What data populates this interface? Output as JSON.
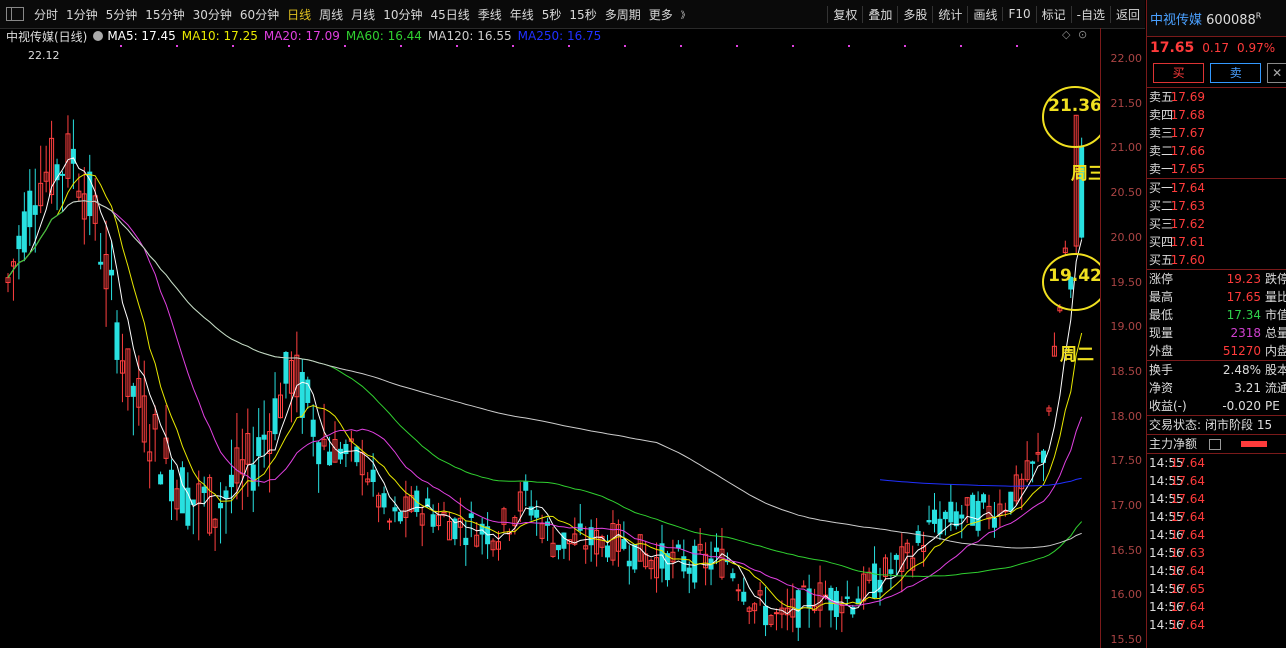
{
  "toolbar": {
    "periods": [
      "分时",
      "1分钟",
      "5分钟",
      "15分钟",
      "30分钟",
      "60分钟",
      "日线",
      "周线",
      "月线",
      "10分钟",
      "45日线",
      "季线",
      "年线",
      "5秒",
      "15秒",
      "多周期",
      "更多"
    ],
    "active_period": "日线",
    "more_arrow": "》",
    "tools": [
      "复权",
      "叠加",
      "多股",
      "统计",
      "画线",
      "F10",
      "标记",
      "-自选",
      "返回"
    ]
  },
  "legend": {
    "title": "中视传媒(日线)",
    "ma5": "MA5: 17.45",
    "ma10": "MA10: 17.25",
    "ma20": "MA20: 17.09",
    "ma60": "MA60: 16.44",
    "ma120": "MA120: 16.55",
    "ma250": "MA250: 16.75",
    "colors": {
      "ma5": "#ffffff",
      "ma10": "#e8e800",
      "ma20": "#e040e0",
      "ma60": "#30d030",
      "ma120": "#cccccc",
      "ma250": "#2030ff"
    }
  },
  "annotations": {
    "max_label": "22.12",
    "circle1": "21.36",
    "circle1_note": "周三",
    "circle2": "19.42",
    "circle2_note": "周二"
  },
  "price_axis": [
    "22.00",
    "21.50",
    "21.00",
    "20.50",
    "20.00",
    "19.50",
    "19.00",
    "18.50",
    "18.00",
    "17.50",
    "17.00",
    "16.50",
    "16.00",
    "15.50"
  ],
  "panel": {
    "name": "中视传媒",
    "code": "600088",
    "code_suffix": "R",
    "price": "17.65",
    "change": "0.17",
    "pct": "0.97%",
    "buy_label": "买",
    "sell_label": "卖",
    "asks": [
      {
        "label": "卖五",
        "price": "17.69"
      },
      {
        "label": "卖四",
        "price": "17.68"
      },
      {
        "label": "卖三",
        "price": "17.67"
      },
      {
        "label": "卖二",
        "price": "17.66"
      },
      {
        "label": "卖一",
        "price": "17.65"
      }
    ],
    "bids": [
      {
        "label": "买一",
        "price": "17.64"
      },
      {
        "label": "买二",
        "price": "17.63"
      },
      {
        "label": "买三",
        "price": "17.62"
      },
      {
        "label": "买四",
        "price": "17.61"
      },
      {
        "label": "买五",
        "price": "17.60"
      }
    ],
    "stats": [
      {
        "label": "涨停",
        "value": "19.23",
        "extra": "跌停"
      },
      {
        "label": "最高",
        "value": "17.65",
        "extra": "量比"
      },
      {
        "label": "最低",
        "value": "17.34",
        "extra": "市值"
      },
      {
        "label": "现量",
        "value": "2318",
        "extra": "总量"
      },
      {
        "label": "外盘",
        "value": "51270",
        "extra": "内盘"
      }
    ],
    "stats2": [
      {
        "label": "换手",
        "value": "2.48%",
        "extra": "股本"
      },
      {
        "label": "净资",
        "value": "3.21",
        "extra": "流通"
      },
      {
        "label": "收益(-)",
        "value": "-0.020",
        "extra": "PE"
      }
    ],
    "trade_status_label": "交易状态:",
    "trade_status": "闭市阶段 15",
    "main_net_label": "主力净额",
    "ticks": [
      {
        "time": "14:55",
        "price": "17.64"
      },
      {
        "time": "14:55",
        "price": "17.64"
      },
      {
        "time": "14:55",
        "price": "17.64"
      },
      {
        "time": "14:55",
        "price": "17.64"
      },
      {
        "time": "14:56",
        "price": "17.64"
      },
      {
        "time": "14:56",
        "price": "17.63"
      },
      {
        "time": "14:56",
        "price": "17.64"
      },
      {
        "time": "14:56",
        "price": "17.65"
      },
      {
        "time": "14:56",
        "price": "17.64"
      },
      {
        "time": "14:56",
        "price": "17.64"
      }
    ]
  }
}
